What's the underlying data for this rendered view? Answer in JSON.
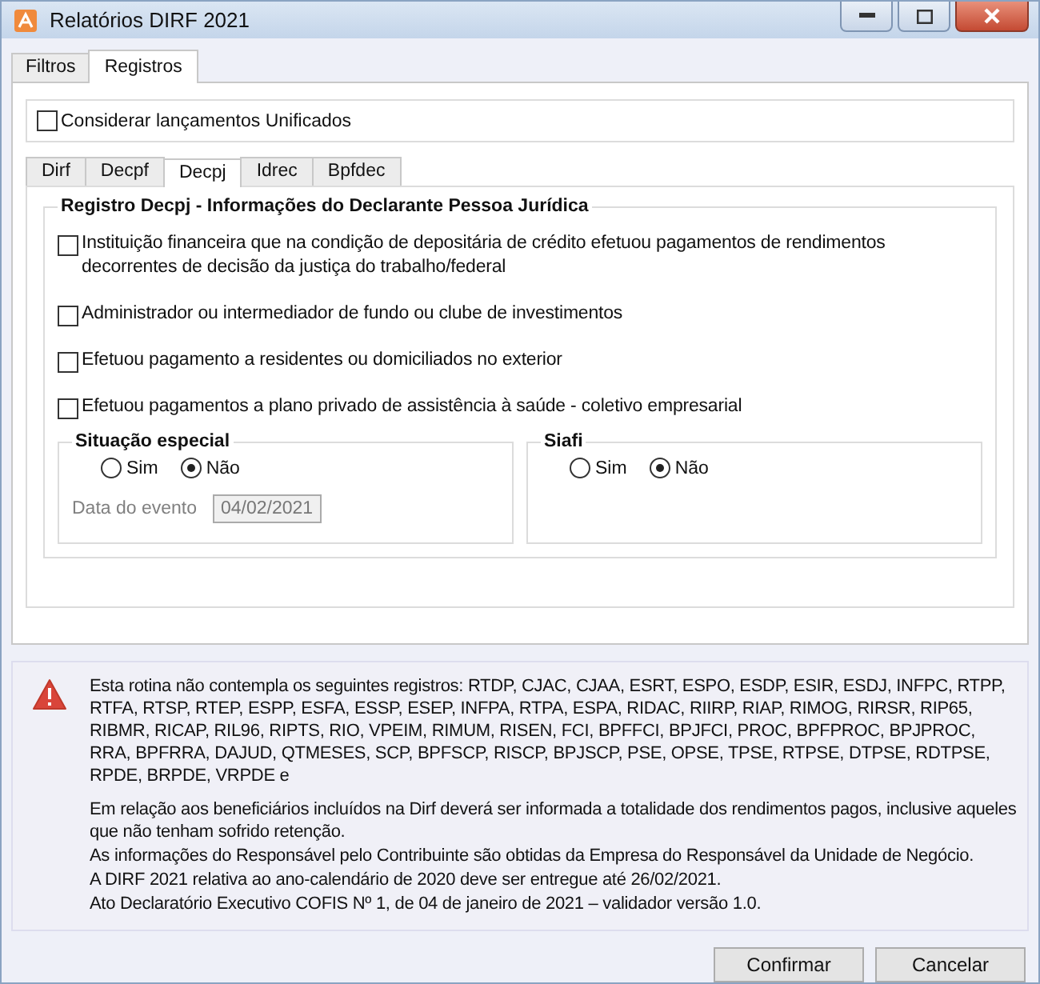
{
  "window": {
    "title": "Relatórios DIRF 2021"
  },
  "tabs": [
    {
      "label": "Filtros",
      "selected": false
    },
    {
      "label": "Registros",
      "selected": true
    }
  ],
  "unified": {
    "label": "Considerar lançamentos Unificados",
    "checked": false
  },
  "subtabs": [
    {
      "label": "Dirf",
      "selected": false
    },
    {
      "label": "Decpf",
      "selected": false
    },
    {
      "label": "Decpj",
      "selected": true
    },
    {
      "label": "Idrec",
      "selected": false
    },
    {
      "label": "Bpfdec",
      "selected": false
    }
  ],
  "group": {
    "title": "Registro Decpj - Informações do Declarante Pessoa Jurídica",
    "options": [
      {
        "label": "Instituição financeira que na condição de depositária de crédito efetuou pagamentos de rendimentos decorrentes de decisão da justiça do trabalho/federal",
        "checked": false
      },
      {
        "label": "Administrador ou intermediador de fundo ou clube de investimentos",
        "checked": false
      },
      {
        "label": "Efetuou pagamento a residentes ou domiciliados no exterior",
        "checked": false
      },
      {
        "label": "Efetuou pagamentos a plano privado de assistência à saúde - coletivo empresarial",
        "checked": false
      }
    ],
    "situacao": {
      "title": "Situação especial",
      "radios": [
        {
          "label": "Sim",
          "selected": false
        },
        {
          "label": "Não",
          "selected": true
        }
      ],
      "date_label": "Data do evento",
      "date_value": "04/02/2021",
      "date_disabled": true
    },
    "siafi": {
      "title": "Siafi",
      "radios": [
        {
          "label": "Sim",
          "selected": false
        },
        {
          "label": "Não",
          "selected": true
        }
      ]
    }
  },
  "notice": [
    "Esta rotina não contempla os seguintes registros: RTDP, CJAC, CJAA, ESRT, ESPO, ESDP, ESIR, ESDJ, INFPC, RTPP, RTFA, RTSP, RTEP, ESPP, ESFA, ESSP, ESEP, INFPA, RTPA, ESPA, RIDAC, RIIRP, RIAP, RIMOG, RIRSR, RIP65, RIBMR, RICAP, RIL96, RIPTS, RIO, VPEIM, RIMUM, RISEN, FCI, BPFFCI, BPJFCI, PROC, BPFPROC, BPJPROC, RRA, BPFRRA, DAJUD, QTMESES, SCP, BPFSCP, RISCP, BPJSCP, PSE, OPSE, TPSE, RTPSE, DTPSE, RDTPSE, RPDE, BRPDE, VRPDE e",
    "Em relação aos beneficiários incluídos na Dirf deverá ser informada a totalidade dos rendimentos pagos, inclusive aqueles que não tenham sofrido retenção.",
    "As informações do Responsável pelo Contribuinte são obtidas da Empresa do Responsável da Unidade de Negócio.",
    "A DIRF 2021 relativa ao ano-calendário de 2020 deve ser entregue até 26/02/2021.",
    "Ato Declaratório Executivo COFIS Nº 1, de 04 de janeiro de 2021 – validador versão 1.0."
  ],
  "buttons": [
    "Confirmar",
    "Cancelar"
  ]
}
